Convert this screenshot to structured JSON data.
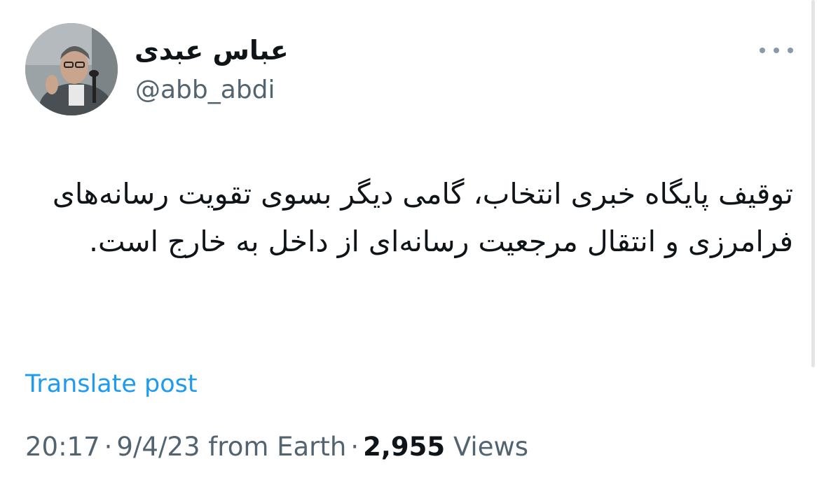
{
  "author": {
    "display_name": "عباس عبدی",
    "handle": "@abb_abdi"
  },
  "tweet": {
    "text": "توقیف پایگاه خبری انتخاب، گامی دیگر بسوی تقویت رسانه‌های فرامرزی و انتقال مرجعیت رسانه‌ای از داخل به خارج است."
  },
  "translate_label": "Translate post",
  "meta": {
    "time": "20:17",
    "separator": "·",
    "date": "9/4/23",
    "source": "from Earth",
    "views_count": "2,955",
    "views_label": "Views"
  },
  "icons": {
    "more": "more-horizontal-icon"
  },
  "colors": {
    "link": "#1d9bf0",
    "secondary_text": "#536471",
    "primary_text": "#0f1419"
  }
}
